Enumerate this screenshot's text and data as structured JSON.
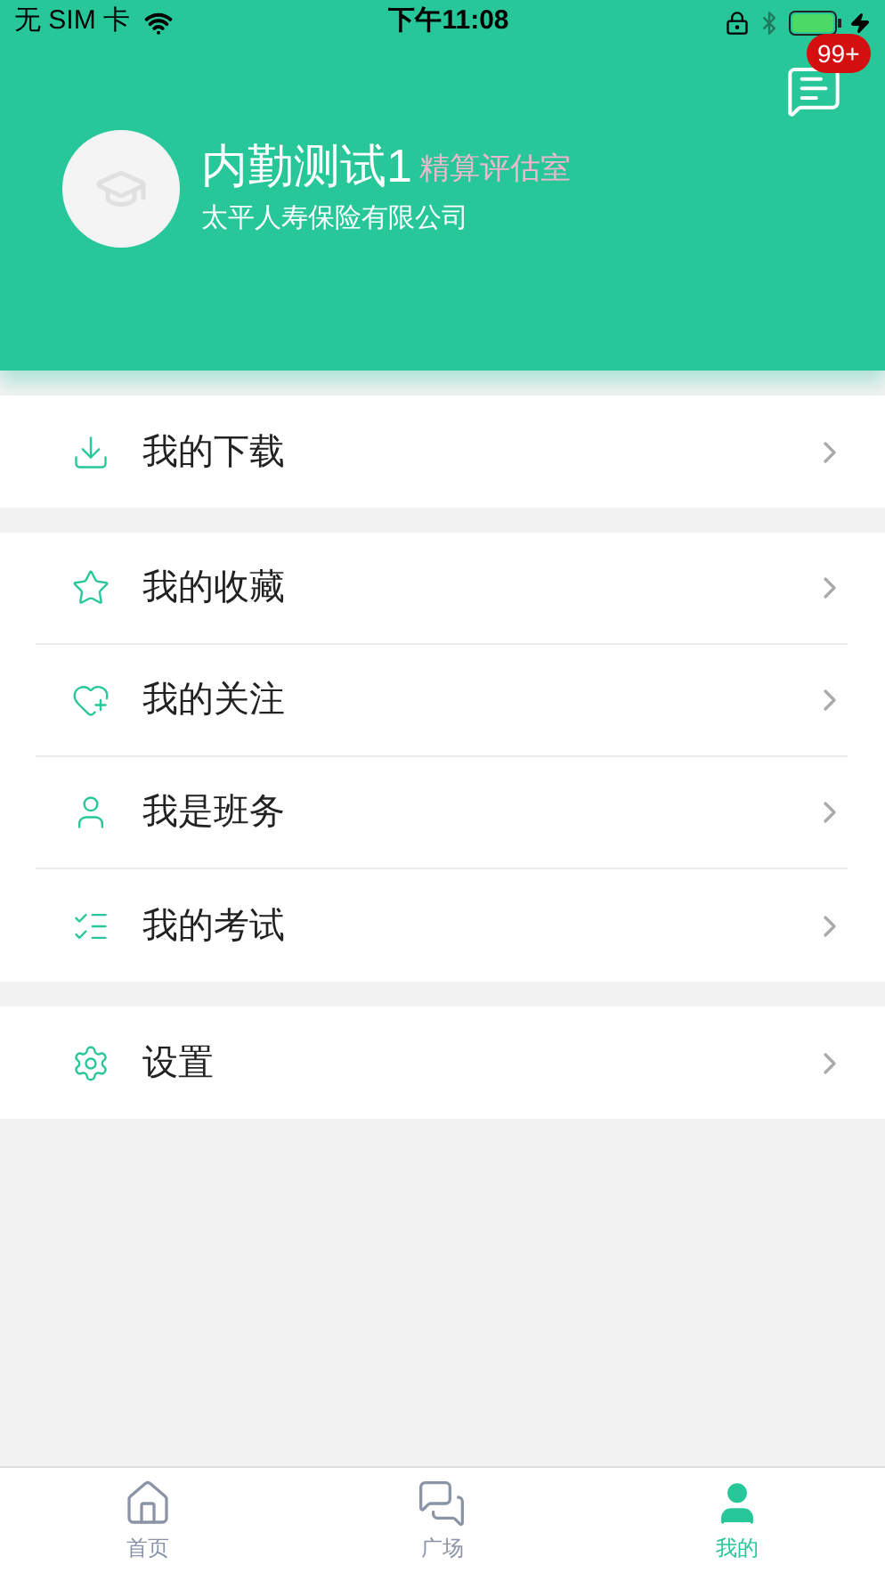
{
  "status_bar": {
    "carrier": "无 SIM 卡",
    "time": "下午11:08"
  },
  "header": {
    "message_badge": "99+",
    "name": "内勤测试1",
    "department": "精算评估室",
    "company": "太平人寿保险有限公司"
  },
  "menu_groups": [
    [
      {
        "kind": "download",
        "label": "我的下载"
      }
    ],
    [
      {
        "kind": "star",
        "label": "我的收藏"
      },
      {
        "kind": "follow",
        "label": "我的关注"
      },
      {
        "kind": "monitor",
        "label": "我是班务"
      },
      {
        "kind": "exam",
        "label": "我的考试"
      }
    ],
    [
      {
        "kind": "settings",
        "label": "设置"
      }
    ]
  ],
  "tab_bar": [
    {
      "kind": "home",
      "label": "首页",
      "selected": false
    },
    {
      "kind": "square",
      "label": "广场",
      "selected": false
    },
    {
      "kind": "me",
      "label": "我的",
      "selected": true
    }
  ]
}
